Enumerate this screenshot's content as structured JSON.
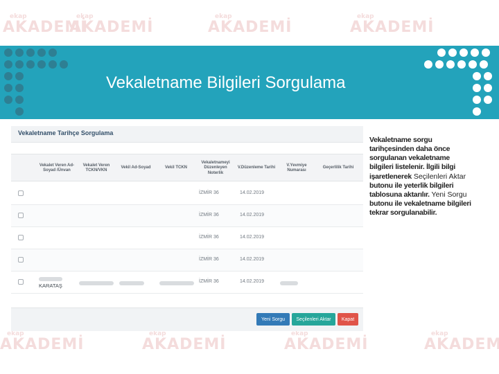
{
  "watermark": {
    "small": "ekap",
    "large": "AKADEMİ"
  },
  "header": {
    "title": "Vekaletname Bilgileri Sorgulama"
  },
  "panel": {
    "title": "Vekaletname Tarihçe Sorgulama",
    "columns": [
      "Vekalet Veren Ad-Soyad /Ünvan",
      "Vekalet Veren TCKN/VKN",
      "Vekil Ad-Soyad",
      "Vekil TCKN",
      "Vekaletnameyi Düzenleyen Noterlik",
      "V.Düzenleme Tarihi",
      "V.Yevmiye Numarası",
      "Geçerlilik Tarihi"
    ],
    "rows": [
      {
        "noterlik": "İZMİR 36",
        "tarih": "14.02.2019"
      },
      {
        "noterlik": "İZMİR 36",
        "tarih": "14.02.2019"
      },
      {
        "noterlik": "İZMİR 36",
        "tarih": "14.02.2019"
      },
      {
        "noterlik": "İZMİR 36",
        "tarih": "14.02.2019"
      },
      {
        "noterlik": "İZMİR 36",
        "tarih": "14.02.2019",
        "veren": "KARATAŞ"
      }
    ],
    "buttons": {
      "query": "Yeni Sorgu",
      "transfer": "Seçilenleri Aktar",
      "close": "Kapat"
    }
  },
  "description": {
    "p1": "Vekaletname sorgu tarihçesinden daha önce sorgulanan vekaletname bilgileri listelenir. İlgili bilgi işaretlenerek",
    "p2": "Seçilenleri Aktar",
    "p3": "butonu ile yeterlik bilgileri tablosuna aktarılır.",
    "p4": "Yeni Sorgu",
    "p5": "butonu ile vekaletname bilgileri tekrar sorgulanabilir."
  },
  "colors": {
    "band": "#23a3bb",
    "primary": "#337ab7",
    "success": "#26a69a",
    "danger": "#e05449"
  }
}
